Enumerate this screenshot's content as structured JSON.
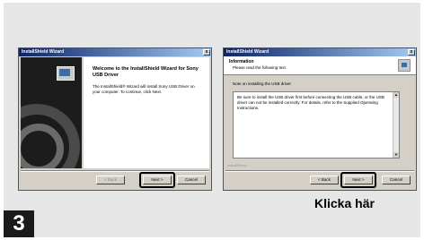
{
  "wizard1": {
    "title": "InstallShield Wizard",
    "close_glyph": "x",
    "heading": "Welcome to the InstallShield Wizard for Sony USB Driver",
    "body": "The InstallShield® Wizard will install Sony USB Driver on your computer. To continue, click Next.",
    "back_label": "< Back",
    "next_label": "Next >",
    "cancel_label": "Cancel"
  },
  "wizard2": {
    "title": "InstallShield Wizard",
    "close_glyph": "x",
    "header_title": "Information",
    "header_subtitle": "Please read the following text.",
    "note": "Note on installing the USB driver",
    "text": "Be sure to install the USB driver first before connecting the USB cable, or the USB driver can not be installed correctly. For details, refer to the Supplied Operating Instructions.",
    "footer_brand": "InstallShield",
    "back_label": "< Back",
    "next_label": "Next >",
    "cancel_label": "Cancel"
  },
  "step_number": "3",
  "click_here": "Klicka här"
}
